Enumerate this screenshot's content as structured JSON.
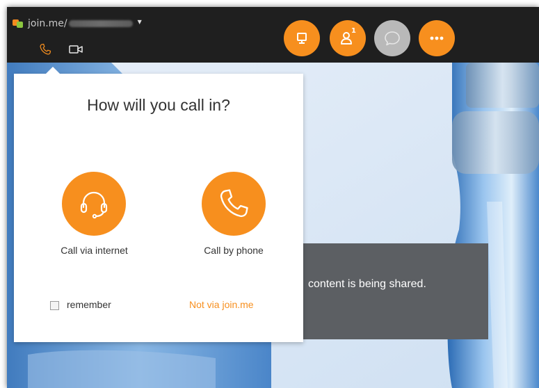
{
  "app": {
    "brand_text": "join.me/",
    "brand_logo": "join-me-logo",
    "accent_color": "#f78f1e",
    "secondary_accent": "#8cc63f"
  },
  "header": {
    "tabs": [
      {
        "icon": "phone-icon",
        "active": true
      },
      {
        "icon": "video-camera-icon",
        "active": false
      }
    ],
    "buttons": [
      {
        "icon": "screen-share-icon"
      },
      {
        "icon": "people-icon",
        "badge": "1"
      },
      {
        "icon": "chat-icon",
        "disabled": true
      },
      {
        "icon": "more-icon"
      }
    ]
  },
  "stage": {
    "status_text": "content is being shared."
  },
  "popup": {
    "title": "How will you call in?",
    "options": [
      {
        "label": "Call via internet",
        "icon": "headset-icon"
      },
      {
        "label": "Call by phone",
        "icon": "phone-icon"
      }
    ],
    "remember_label": "remember",
    "remember_checked": false,
    "alt_link": "Not via join.me"
  }
}
